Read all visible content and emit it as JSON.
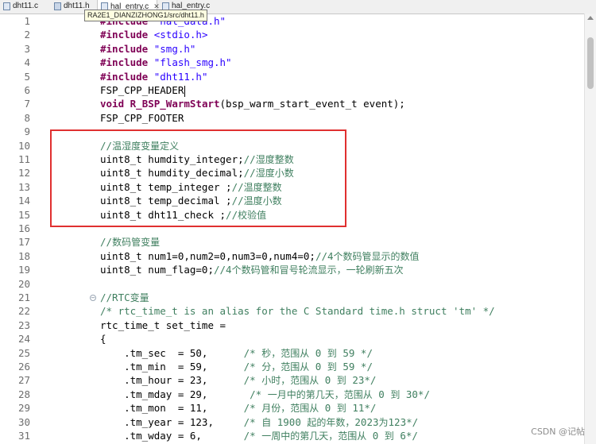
{
  "tabs": [
    {
      "label": "dht11.c",
      "type": "c"
    },
    {
      "label": "dht11.h",
      "type": "h"
    },
    {
      "label": "hal_entry.c",
      "type": "c",
      "active": true
    },
    {
      "label": "hal_entry.c",
      "type": "c"
    }
  ],
  "tooltip": "RA2E1_DIANZIZHONG1/src/dht11.h",
  "lines": [
    {
      "n": "1",
      "tokens": [
        {
          "c": "kw",
          "t": "#include"
        },
        {
          "c": "",
          "t": " "
        },
        {
          "c": "str",
          "t": "\"hal_data.h\""
        }
      ]
    },
    {
      "n": "2",
      "tokens": [
        {
          "c": "kw",
          "t": "#include"
        },
        {
          "c": "",
          "t": " "
        },
        {
          "c": "str",
          "t": "<stdio.h>"
        }
      ]
    },
    {
      "n": "3",
      "tokens": [
        {
          "c": "kw",
          "t": "#include"
        },
        {
          "c": "",
          "t": " "
        },
        {
          "c": "str",
          "t": "\"smg.h\""
        }
      ]
    },
    {
      "n": "4",
      "tokens": [
        {
          "c": "kw",
          "t": "#include"
        },
        {
          "c": "",
          "t": " "
        },
        {
          "c": "str",
          "t": "\"flash_smg.h\""
        }
      ]
    },
    {
      "n": "5",
      "tokens": [
        {
          "c": "kw",
          "t": "#include"
        },
        {
          "c": "",
          "t": " "
        },
        {
          "c": "str",
          "t": "\"dht11.h\""
        }
      ]
    },
    {
      "n": "6",
      "tokens": [
        {
          "c": "",
          "t": "FSP_CPP_HEADER"
        }
      ],
      "caret": true
    },
    {
      "n": "7",
      "tokens": [
        {
          "c": "kw",
          "t": "void"
        },
        {
          "c": "",
          "t": " "
        },
        {
          "c": "kw",
          "t": "R_BSP_WarmStart"
        },
        {
          "c": "",
          "t": "(bsp_warm_start_event_t event);"
        }
      ]
    },
    {
      "n": "8",
      "tokens": [
        {
          "c": "",
          "t": "FSP_CPP_FOOTER"
        }
      ]
    },
    {
      "n": "9",
      "tokens": []
    },
    {
      "n": "10",
      "tokens": [
        {
          "c": "cmt",
          "t": "//"
        },
        {
          "c": "cmt zh",
          "t": "温湿度变量定义"
        }
      ]
    },
    {
      "n": "11",
      "tokens": [
        {
          "c": "",
          "t": "uint8_t humdity_integer;"
        },
        {
          "c": "cmt",
          "t": "//"
        },
        {
          "c": "cmt zh",
          "t": "湿度整数"
        }
      ]
    },
    {
      "n": "12",
      "tokens": [
        {
          "c": "",
          "t": "uint8_t humdity_decimal;"
        },
        {
          "c": "cmt",
          "t": "//"
        },
        {
          "c": "cmt zh",
          "t": "湿度小数"
        }
      ]
    },
    {
      "n": "13",
      "tokens": [
        {
          "c": "",
          "t": "uint8_t temp_integer ;"
        },
        {
          "c": "cmt",
          "t": "//"
        },
        {
          "c": "cmt zh",
          "t": "温度整数"
        }
      ]
    },
    {
      "n": "14",
      "tokens": [
        {
          "c": "",
          "t": "uint8_t temp_decimal ;"
        },
        {
          "c": "cmt",
          "t": "//"
        },
        {
          "c": "cmt zh",
          "t": "温度小数"
        }
      ]
    },
    {
      "n": "15",
      "tokens": [
        {
          "c": "",
          "t": "uint8_t dht11_check ;"
        },
        {
          "c": "cmt",
          "t": "//"
        },
        {
          "c": "cmt zh",
          "t": "校验值"
        }
      ]
    },
    {
      "n": "16",
      "tokens": []
    },
    {
      "n": "17",
      "tokens": [
        {
          "c": "cmt",
          "t": "//"
        },
        {
          "c": "cmt zh",
          "t": "数码管变量"
        }
      ]
    },
    {
      "n": "18",
      "tokens": [
        {
          "c": "",
          "t": "uint8_t num1=0,num2=0,num3=0,num4=0;"
        },
        {
          "c": "cmt",
          "t": "//4"
        },
        {
          "c": "cmt zh",
          "t": "个数码管显示的数值"
        }
      ]
    },
    {
      "n": "19",
      "tokens": [
        {
          "c": "",
          "t": "uint8_t num_flag=0;"
        },
        {
          "c": "cmt",
          "t": "//4"
        },
        {
          "c": "cmt zh",
          "t": "个数码管和冒号轮流显示，一轮刷新五次"
        }
      ]
    },
    {
      "n": "20",
      "tokens": []
    },
    {
      "n": "21",
      "tokens": [
        {
          "c": "cmt",
          "t": "//RTC"
        },
        {
          "c": "cmt zh",
          "t": "变量"
        }
      ],
      "fold": true
    },
    {
      "n": "22",
      "tokens": [
        {
          "c": "cmt",
          "t": "/* rtc_time_t is an alias for the C Standard time.h struct 'tm' */"
        }
      ]
    },
    {
      "n": "23",
      "tokens": [
        {
          "c": "",
          "t": "rtc_time_t set_time ="
        }
      ]
    },
    {
      "n": "24",
      "tokens": [
        {
          "c": "",
          "t": "{"
        }
      ]
    },
    {
      "n": "25",
      "tokens": [
        {
          "c": "",
          "t": "    .tm_sec  = 50,      "
        },
        {
          "c": "cmt",
          "t": "/* "
        },
        {
          "c": "cmt zh",
          "t": "秒，范围从"
        },
        {
          "c": "cmt",
          "t": " 0 "
        },
        {
          "c": "cmt zh",
          "t": "到"
        },
        {
          "c": "cmt",
          "t": " 59 */"
        }
      ]
    },
    {
      "n": "26",
      "tokens": [
        {
          "c": "",
          "t": "    .tm_min  = 59,      "
        },
        {
          "c": "cmt",
          "t": "/* "
        },
        {
          "c": "cmt zh",
          "t": "分，范围从"
        },
        {
          "c": "cmt",
          "t": " 0 "
        },
        {
          "c": "cmt zh",
          "t": "到"
        },
        {
          "c": "cmt",
          "t": " 59 */"
        }
      ]
    },
    {
      "n": "27",
      "tokens": [
        {
          "c": "",
          "t": "    .tm_hour = 23,      "
        },
        {
          "c": "cmt",
          "t": "/* "
        },
        {
          "c": "cmt zh",
          "t": "小时，范围从"
        },
        {
          "c": "cmt",
          "t": " 0 "
        },
        {
          "c": "cmt zh",
          "t": "到"
        },
        {
          "c": "cmt",
          "t": " 23*/"
        }
      ]
    },
    {
      "n": "28",
      "tokens": [
        {
          "c": "",
          "t": "    .tm_mday = 29,       "
        },
        {
          "c": "cmt",
          "t": "/* "
        },
        {
          "c": "cmt zh",
          "t": "一月中的第几天，范围从"
        },
        {
          "c": "cmt",
          "t": " 0 "
        },
        {
          "c": "cmt zh",
          "t": "到"
        },
        {
          "c": "cmt",
          "t": " 30*/"
        }
      ]
    },
    {
      "n": "29",
      "tokens": [
        {
          "c": "",
          "t": "    .tm_mon  = 11,      "
        },
        {
          "c": "cmt",
          "t": "/* "
        },
        {
          "c": "cmt zh",
          "t": "月份，范围从"
        },
        {
          "c": "cmt",
          "t": " 0 "
        },
        {
          "c": "cmt zh",
          "t": "到"
        },
        {
          "c": "cmt",
          "t": " 11*/"
        }
      ]
    },
    {
      "n": "30",
      "tokens": [
        {
          "c": "",
          "t": "    .tm_year = 123,     "
        },
        {
          "c": "cmt",
          "t": "/* "
        },
        {
          "c": "cmt zh",
          "t": "自"
        },
        {
          "c": "cmt",
          "t": " 1900 "
        },
        {
          "c": "cmt zh",
          "t": "起的年数，"
        },
        {
          "c": "cmt",
          "t": "2023"
        },
        {
          "c": "cmt zh",
          "t": "为"
        },
        {
          "c": "cmt",
          "t": "123*/"
        }
      ]
    },
    {
      "n": "31",
      "tokens": [
        {
          "c": "",
          "t": "    .tm_wday = 6,       "
        },
        {
          "c": "cmt",
          "t": "/* "
        },
        {
          "c": "cmt zh",
          "t": "一周中的第几天，范围从"
        },
        {
          "c": "cmt",
          "t": " 0 "
        },
        {
          "c": "cmt zh",
          "t": "到"
        },
        {
          "c": "cmt",
          "t": " 6*/"
        }
      ]
    }
  ],
  "watermark": "CSDN @记帖",
  "colors": {
    "keyword": "#7f0055",
    "string": "#2a00ff",
    "comment": "#3f7f5f",
    "highlight_box": "#e03030"
  }
}
